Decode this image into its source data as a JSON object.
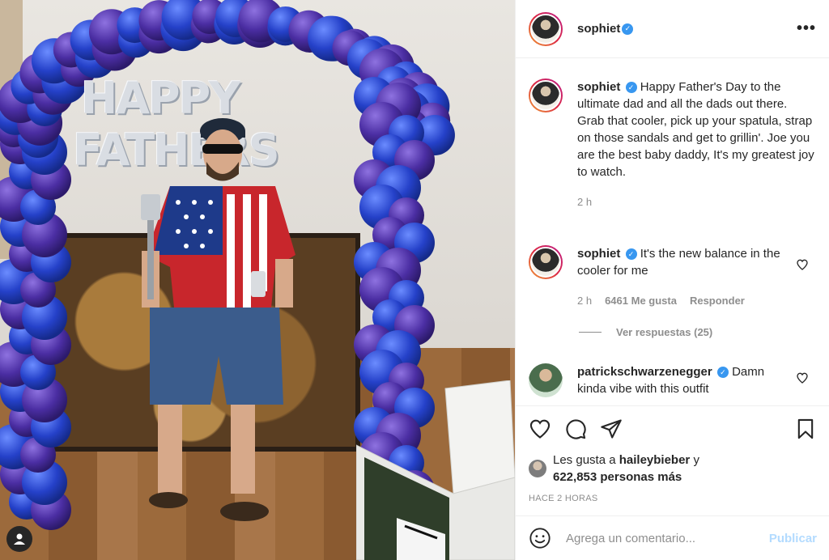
{
  "post": {
    "author": "sophiet",
    "photo_alt": ""
  },
  "photo": {
    "balloon_line1": "HAPPY",
    "balloon_line2": "FATHERS"
  },
  "caption": {
    "username": "sophiet",
    "text": "Happy Father's Day to the ultimate dad and all the dads out there. Grab that cooler, pick up your spatula, strap on those sandals and get to grillin'. Joe you are the best baby daddy, It's my greatest joy to watch.",
    "time": "2 h"
  },
  "comments": [
    {
      "username": "sophiet",
      "text": "It's the new balance in the cooler for me",
      "time": "2 h",
      "likes": "6461 Me gusta",
      "reply_label": "Responder"
    },
    {
      "username": "patrickschwarzenegger",
      "text": "Damn kinda vibe with this outfit"
    }
  ],
  "view_replies": "Ver respuestas (25)",
  "likes": {
    "prefix": "Les gusta a",
    "user": "haileybieber",
    "conj": "y",
    "count": "622,853 personas más"
  },
  "timestamp": "HACE 2 HORAS",
  "add_comment": {
    "placeholder": "Agrega un comentario...",
    "publish_label": "Publicar"
  },
  "colors": {
    "verified": "#3897f0",
    "publish_disabled": "#b3dbff",
    "secondary_text": "#8e8e8e"
  }
}
